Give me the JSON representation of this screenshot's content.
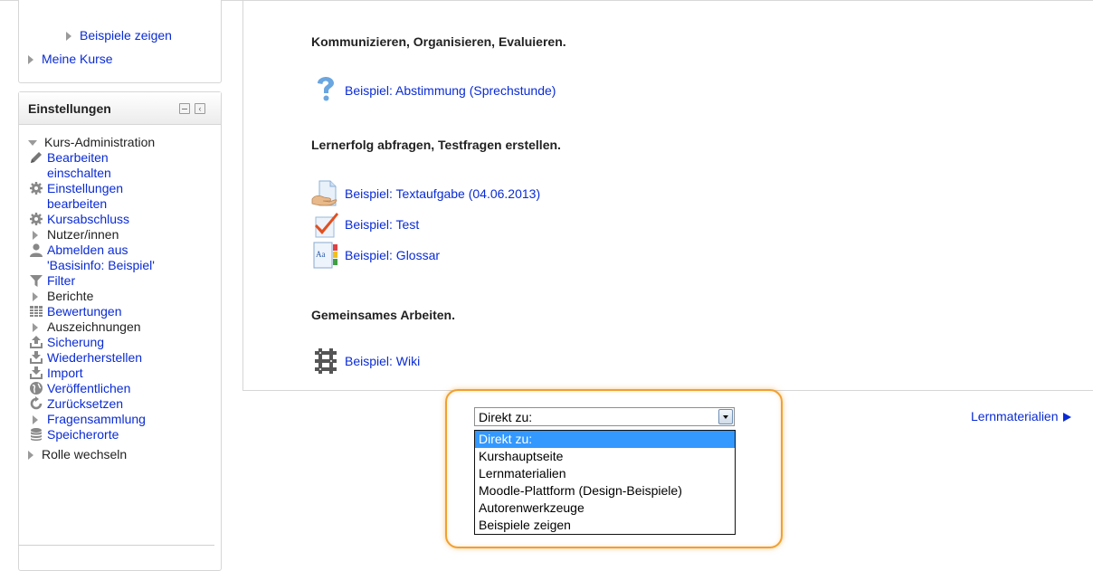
{
  "nav_block": {
    "items": [
      {
        "label": "Beispiele zeigen"
      },
      {
        "label": "Meine Kurse"
      }
    ]
  },
  "settings": {
    "title": "Einstellungen",
    "root": "Kurs-Administration",
    "items": [
      {
        "label": "Bearbeiten einschalten",
        "line1": "Bearbeiten",
        "line2": "einschalten",
        "icon": "pencil-icon",
        "link": true
      },
      {
        "label": "Einstellungen bearbeiten",
        "line1": "Einstellungen",
        "line2": "bearbeiten",
        "icon": "gear-icon",
        "link": true
      },
      {
        "label": "Kursabschluss",
        "icon": "gear-icon",
        "link": true
      },
      {
        "label": "Nutzer/innen",
        "icon": "triangle",
        "link": false
      },
      {
        "label": "Abmelden aus 'Basisinfo: Beispiel'",
        "line1": "Abmelden aus",
        "line2": "'Basisinfo: Beispiel'",
        "icon": "user-icon",
        "link": true
      },
      {
        "label": "Filter",
        "icon": "filter-icon",
        "link": true
      },
      {
        "label": "Berichte",
        "icon": "triangle",
        "link": false
      },
      {
        "label": "Bewertungen",
        "icon": "grades-icon",
        "link": true
      },
      {
        "label": "Auszeichnungen",
        "icon": "triangle",
        "link": false
      },
      {
        "label": "Sicherung",
        "icon": "upload-icon",
        "link": true
      },
      {
        "label": "Wiederherstellen",
        "icon": "download-icon",
        "link": true
      },
      {
        "label": "Import",
        "icon": "download-icon",
        "link": true
      },
      {
        "label": "Veröffentlichen",
        "icon": "globe-icon",
        "link": true
      },
      {
        "label": "Zurücksetzen",
        "icon": "reset-icon",
        "link": true
      },
      {
        "label": "Fragensammlung",
        "icon": "triangle",
        "link": true
      },
      {
        "label": "Speicherorte",
        "icon": "database-icon",
        "link": true
      }
    ],
    "next_root": "Rolle wechseln"
  },
  "sections": [
    {
      "heading": "Kommunizieren, Organisieren, Evaluieren.",
      "activities": [
        {
          "label": "Beispiel: Abstimmung (Sprechstunde)",
          "icon": "question-icon"
        }
      ]
    },
    {
      "heading": "Lernerfolg abfragen, Testfragen erstellen.",
      "activities": [
        {
          "label": "Beispiel: Textaufgabe (04.06.2013)",
          "icon": "assignment-icon"
        },
        {
          "label": "Beispiel: Test",
          "icon": "quiz-icon"
        },
        {
          "label": "Beispiel: Glossar",
          "icon": "glossary-icon"
        }
      ]
    },
    {
      "heading": "Gemeinsames Arbeiten.",
      "activities": [
        {
          "label": "Beispiel: Wiki",
          "icon": "wiki-icon"
        }
      ]
    }
  ],
  "jump_menu": {
    "selected": "Direkt zu:",
    "options": [
      "Direkt zu:",
      "Kurshauptseite",
      "Lernmaterialien",
      "Moodle-Plattform (Design-Beispiele)",
      "Autorenwerkzeuge",
      "Beispiele zeigen"
    ]
  },
  "next_link": "Lernmaterialien",
  "colors": {
    "link": "#0a2bd4",
    "highlight": "#f0a030",
    "selected_option": "#3399ff"
  }
}
